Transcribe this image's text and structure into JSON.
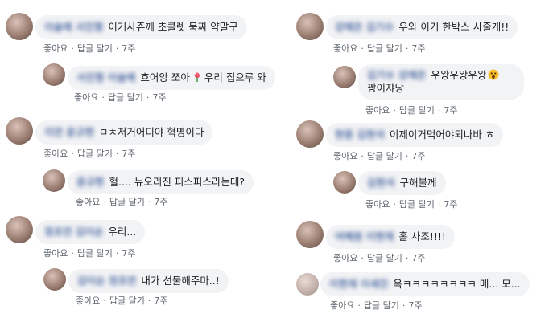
{
  "actions": {
    "like": "좋아요",
    "reply": "답글 달기",
    "dot": "·"
  },
  "left": [
    {
      "name": "이슬예 서진형",
      "text": "이거사쥬께 초콜렛 묵짜 약말구",
      "time": "7주"
    },
    {
      "name": "서진형 이슬예",
      "text": "흐어앙 쪼아",
      "text2": "우리 집으루 와",
      "time": "7주"
    },
    {
      "name": "지연 윤규현",
      "text": "ㅁㅊ저거어디야 혁명이다",
      "time": "7주"
    },
    {
      "name": "윤규현",
      "text": "헐.... 뉴오리진 피스피스라는데?",
      "time": "7주"
    },
    {
      "name": "정초연 김이순",
      "text": "우리...",
      "time": "7주"
    },
    {
      "name": "김이순 정초연",
      "text": "내가 선물해주마..!",
      "time": "7주"
    }
  ],
  "right": [
    {
      "name": "강예은 김기수",
      "text": "우와 이거 한박스 사줄게!!",
      "time": "7주"
    },
    {
      "name": "김기수 강예은",
      "text": "우왕우왕우왕",
      "text2": "짱이쟈낭",
      "time": "7주"
    },
    {
      "name": "현종 김현석",
      "text": "이제이거먹어야되나바 ㅎ",
      "time": "7주"
    },
    {
      "name": "김현석",
      "text": "구해볼께",
      "time": "7주"
    },
    {
      "name": "여혜원 이현재",
      "text": "홀 사조!!!!",
      "time": "7주"
    },
    {
      "name": "이현재 이세진",
      "text": "옥ㅋㅋㅋㅋㅋㅋㅋㅋ 메... 모...",
      "time": "7주"
    }
  ],
  "icons": {
    "flower": "tulip-emoji",
    "shock": "shocked-face-emoji"
  }
}
